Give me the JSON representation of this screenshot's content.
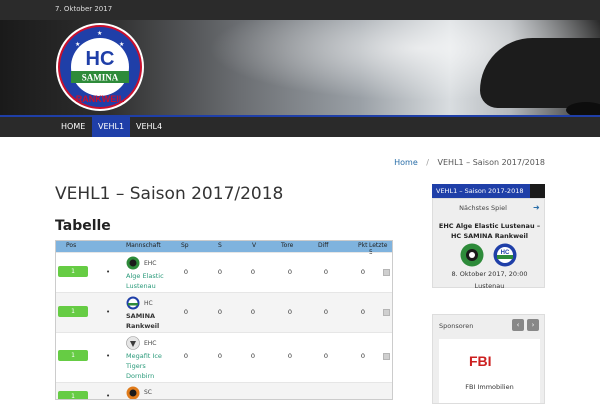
{
  "topbar": {
    "date": "7. Oktober 2017"
  },
  "logo": {
    "text_top": "HC",
    "text_mid": "SAMINA",
    "text_bottom": "RANKWEIL"
  },
  "nav": {
    "items": [
      "HOME",
      "VEHL1",
      "VEHL4"
    ],
    "active": "VEHL1"
  },
  "breadcrumb": {
    "home": "Home",
    "separator": "/",
    "current": "VEHL1 – Saison 2017/2018"
  },
  "page_title": "VEHL1 – Saison 2017/2018",
  "section_title": "Tabelle",
  "table": {
    "headers": [
      "Pos",
      "Mannschaft",
      "Sp",
      "S",
      "V",
      "Tore",
      "Diff",
      "Pkt",
      "Letzte 5"
    ],
    "rows": [
      {
        "pos": "1",
        "abbr": "EHC",
        "team": "Alge Elastic Lustenau",
        "sp": "0",
        "s": "0",
        "v": "0",
        "tore": "0",
        "diff": "0",
        "pkt": "0"
      },
      {
        "pos": "1",
        "abbr": "HC",
        "team": "SAMINA Rankweil",
        "sp": "0",
        "s": "0",
        "v": "0",
        "tore": "0",
        "diff": "0",
        "pkt": "0"
      },
      {
        "pos": "1",
        "abbr": "EHC",
        "team": "Megafit Ice Tigers Dornbirn",
        "sp": "0",
        "s": "0",
        "v": "0",
        "tore": "0",
        "diff": "0",
        "pkt": "0"
      },
      {
        "pos": "1",
        "abbr": "SC",
        "team": "",
        "sp": "",
        "s": "",
        "v": "",
        "tore": "",
        "diff": "",
        "pkt": ""
      }
    ]
  },
  "sidebar": {
    "widget_title": "VEHL1 – Saison 2017-2018",
    "next_label": "Nächstes Spiel",
    "match_title": "EHC Alge Elastic Lustenau – HC SAMINA Rankweil",
    "match_date": "8. Oktober 2017, 20:00",
    "match_place": "Lustenau",
    "sponsors_title": "Sponsoren",
    "sponsor_prev": "‹",
    "sponsor_next": "›",
    "sponsor_logo_text": "FBI",
    "sponsor_name": "FBI Immobilien"
  },
  "colors": {
    "accent": "#1f3fa8",
    "green": "#66cc44",
    "table_header": "#7fb3de",
    "team_link": "#2a9a7a"
  }
}
